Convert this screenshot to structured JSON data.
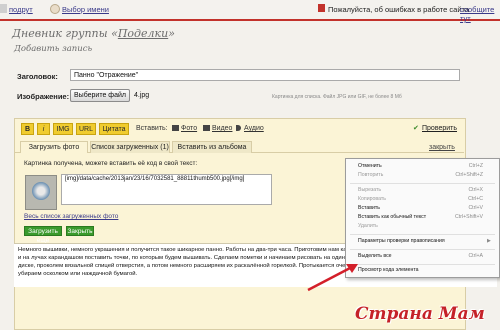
{
  "topbar": {
    "left_link": "подрут",
    "choose_name": "Выбор имени",
    "notice": "Пожалуйста, об ошибках в работе сайта",
    "report_link": "сообщите тут"
  },
  "page": {
    "title_prefix": "Дневник группы «",
    "title_link": "Поделки",
    "title_suffix": "»",
    "subtitle": "Добавить запись"
  },
  "form": {
    "heading_label": "Заголовок:",
    "heading_value": "Панно \"Отражение\"",
    "image_label": "Изображение:",
    "choose_file_button": "Выберите файл",
    "file_name": "4.jpg",
    "image_hint": "Картинка для списка. Файл JPG или GIF, не более 8 Мб"
  },
  "editor": {
    "bold": "B",
    "italic": "i",
    "img": "IMG",
    "url": "URL",
    "quote": "Цитата",
    "insert_label": "Вставить:",
    "photo": "Фото",
    "video": "Видео",
    "audio": "Аудио",
    "check": "Проверить",
    "tabs": [
      "Загрузить фото",
      "Список загруженных (1)",
      "Вставить из альбома"
    ],
    "close_link": "закрыть",
    "received_text": "Картинка получена, можете вставить её код в свой текст:",
    "image_code": "[img]/data/cache/2013jan/23/16/7032581_88811thumb500.jpg[/img]",
    "full_list_link": "Весь список загруженных фото",
    "upload_more": "Загрузить ещё",
    "close_button": "Закрыть",
    "body_text": "Немного вышивки, немного украшения и получится такое шикарное панно. Работы на два-три часа. Приготовим нам карандашом разметку, как на фото. По внешнему кругу и на лучах карандашом поставить точки, по которым будем вышивать. Сделаем пометки и начинаем рисовать на одинаковом расстоянии друг от друга. Чтобы вышить на диске, проколем вязальной спицей отверстия, а потом немного расширяем их раскалённой горелкой. Протыкается очень легко. После того, как проткнули всё, заусенки убираем осколком или наждачной бумагой."
  },
  "context_menu": {
    "items": [
      {
        "label": "Отменить",
        "shortcut": "Ctrl+Z",
        "disabled": false
      },
      {
        "label": "Повторить",
        "shortcut": "Ctrl+Shift+Z",
        "disabled": true
      },
      {
        "label": "Вырезать",
        "shortcut": "Ctrl+X",
        "disabled": true
      },
      {
        "label": "Копировать",
        "shortcut": "Ctrl+C",
        "disabled": true
      },
      {
        "label": "Вставить",
        "shortcut": "Ctrl+V",
        "disabled": false
      },
      {
        "label": "Вставить как обычный текст",
        "shortcut": "Ctrl+Shift+V",
        "disabled": false
      },
      {
        "label": "Удалить",
        "shortcut": "",
        "disabled": true
      },
      {
        "label": "Параметры проверки правописания",
        "shortcut": "",
        "disabled": false
      },
      {
        "label": "Выделить все",
        "shortcut": "Ctrl+A",
        "disabled": false
      },
      {
        "label": "Просмотр кода элемента",
        "shortcut": "",
        "disabled": false
      }
    ]
  },
  "watermark": "Страна Мам",
  "colors": {
    "accent_red": "#c2322b",
    "editor_bg": "#fbf4d6",
    "toolbar_button": "#f0cc2e",
    "green_button": "#3a9a2c",
    "link": "#3a3a8a"
  }
}
